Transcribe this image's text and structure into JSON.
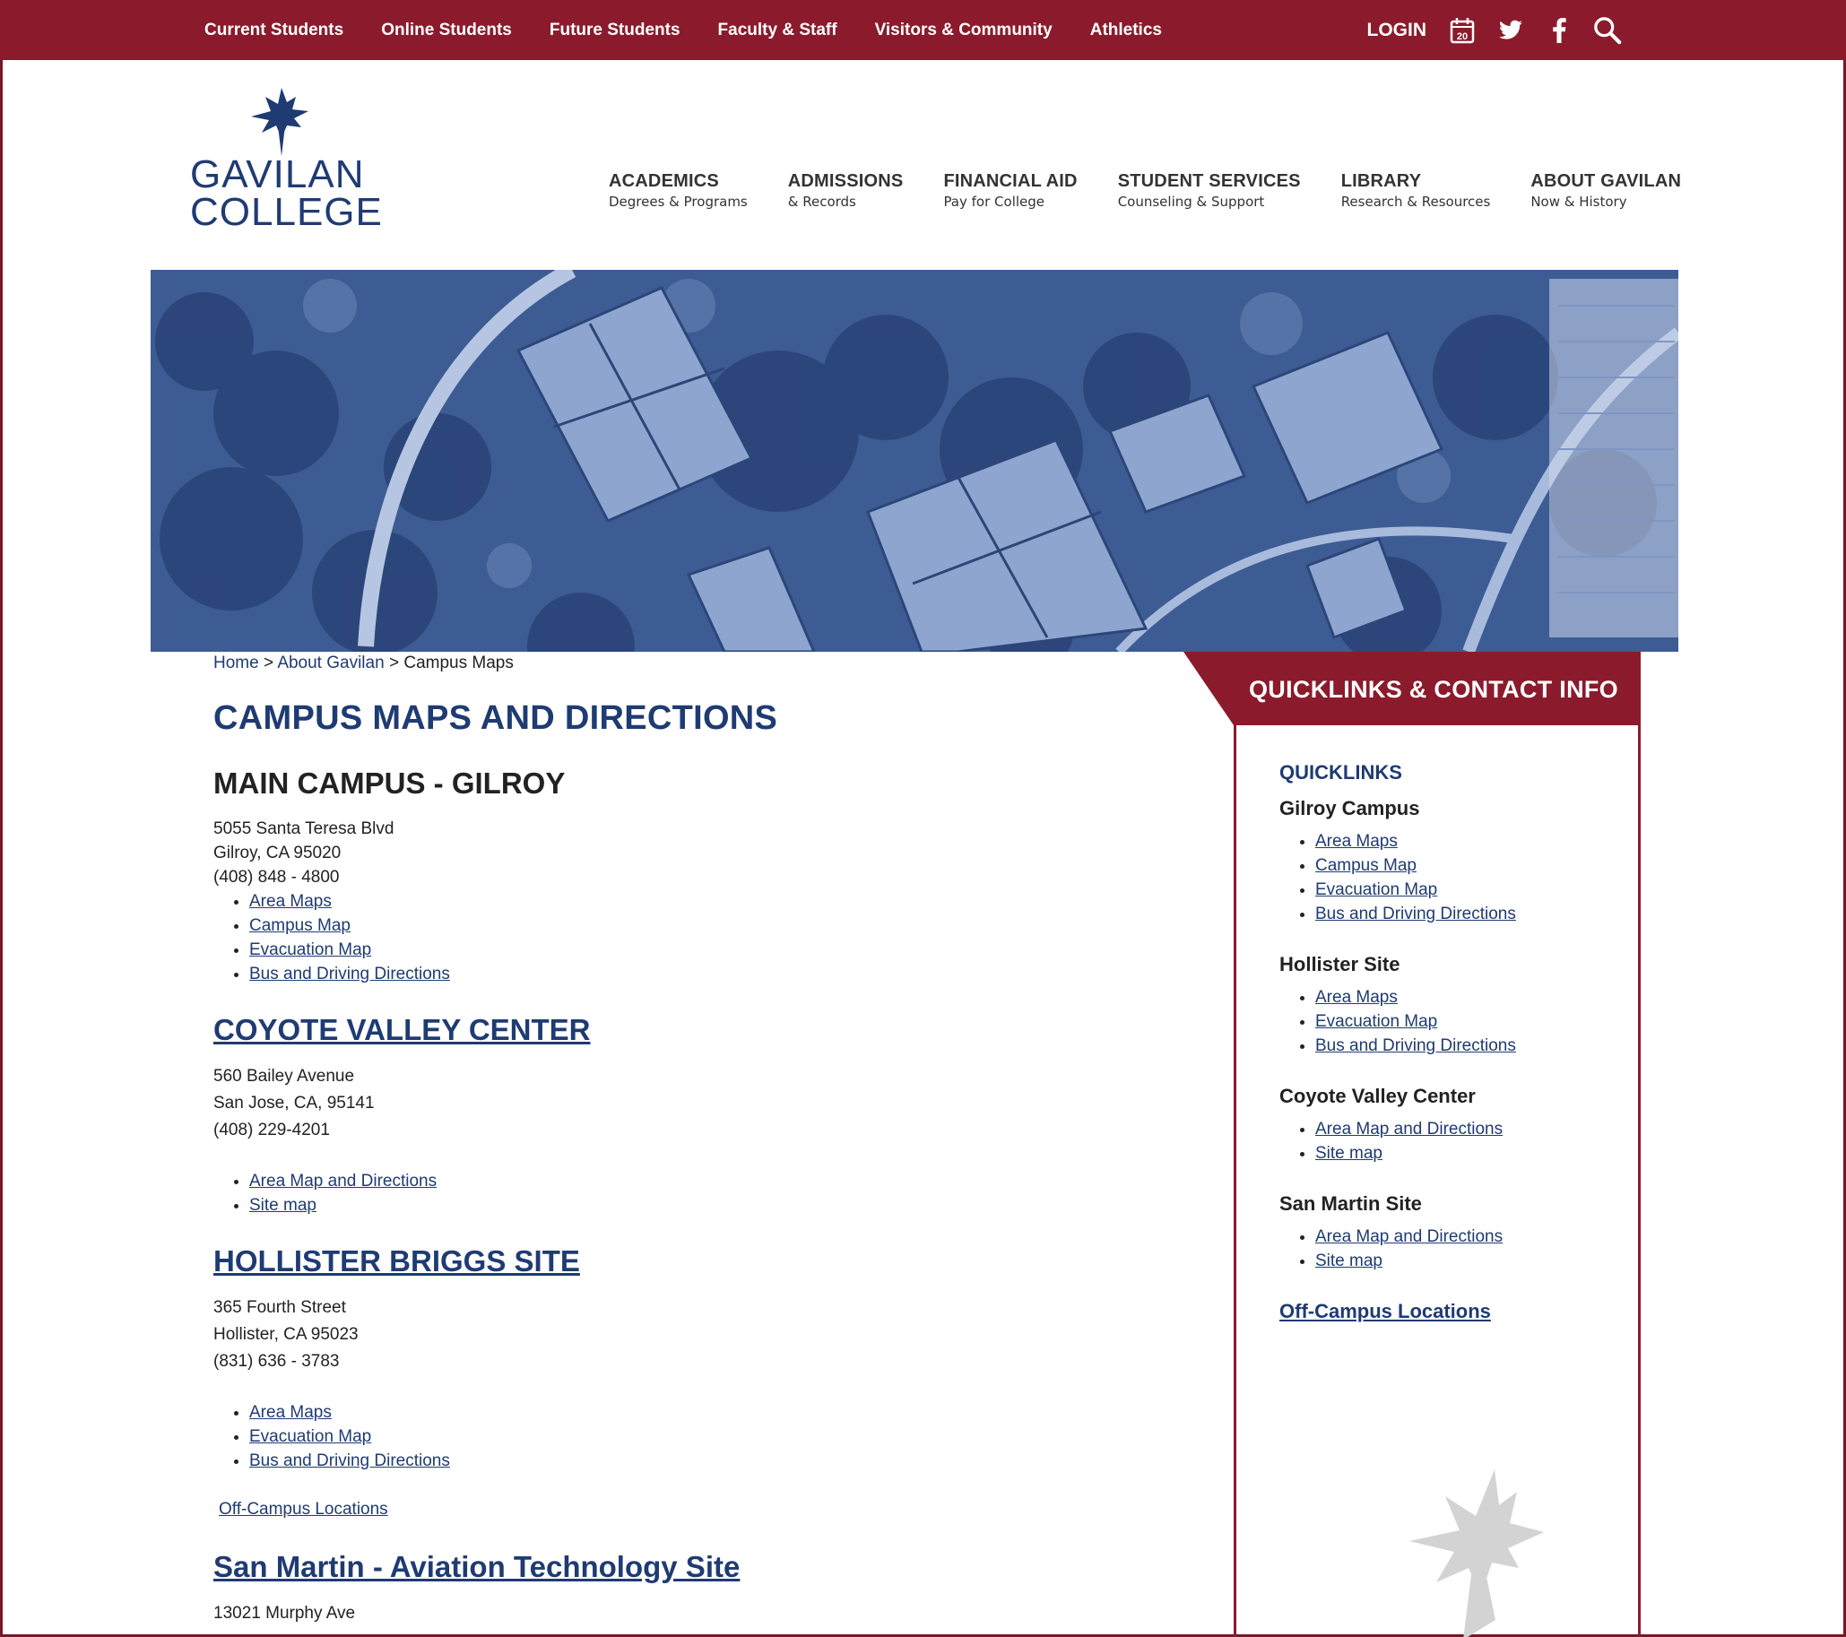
{
  "topbar": {
    "links": [
      "Current Students",
      "Online Students",
      "Future Students",
      "Faculty & Staff",
      "Visitors & Community",
      "Athletics"
    ],
    "login": "LOGIN",
    "calendar_day": "20"
  },
  "logo": {
    "line1": "GAVILAN",
    "line2": "COLLEGE"
  },
  "mainnav": [
    {
      "title": "ACADEMICS",
      "sub": "Degrees & Programs"
    },
    {
      "title": "ADMISSIONS",
      "sub": "& Records"
    },
    {
      "title": "FINANCIAL AID",
      "sub": "Pay for College"
    },
    {
      "title": "STUDENT SERVICES",
      "sub": "Counseling & Support"
    },
    {
      "title": "LIBRARY",
      "sub": "Research & Resources"
    },
    {
      "title": "ABOUT GAVILAN",
      "sub": "Now & History"
    }
  ],
  "breadcrumb": {
    "home": "Home",
    "sep": ">",
    "about": "About Gavilan",
    "current": "Campus Maps"
  },
  "page_title": "CAMPUS MAPS AND DIRECTIONS",
  "main_campus": {
    "heading": "MAIN CAMPUS - GILROY",
    "address": [
      "5055 Santa Teresa Blvd",
      "Gilroy, CA 95020",
      "(408) 848 - 4800"
    ],
    "links": [
      "Area Maps",
      "Campus Map",
      "Evacuation Map",
      "Bus and Driving Directions"
    ]
  },
  "coyote": {
    "heading": "COYOTE VALLEY CENTER",
    "address": [
      "560 Bailey Avenue",
      "San Jose, CA, 95141",
      "(408) 229-4201"
    ],
    "links": [
      "Area Map and Directions",
      "Site map"
    ]
  },
  "hollister": {
    "heading": "HOLLISTER BRIGGS SITE",
    "address": [
      "365 Fourth Street",
      "Hollister, CA 95023",
      "(831) 636 - 3783"
    ],
    "links": [
      "Area Maps",
      "Evacuation Map",
      "Bus and Driving Directions"
    ],
    "off_campus": "Off-Campus Locations"
  },
  "san_martin": {
    "heading": "San Martin - Aviation Technology Site",
    "address": [
      "13021 Murphy Ave"
    ]
  },
  "sidebar": {
    "header": "QUICKLINKS & CONTACT INFO",
    "title": "QUICKLINKS",
    "groups": [
      {
        "name": "Gilroy Campus",
        "links": [
          "Area Maps",
          "Campus Map",
          "Evacuation Map",
          "Bus and Driving Directions"
        ]
      },
      {
        "name": "Hollister Site",
        "links": [
          "Area Maps",
          "Evacuation Map",
          "Bus and Driving Directions"
        ]
      },
      {
        "name": "Coyote Valley Center",
        "links": [
          "Area Map and Directions",
          "Site map"
        ]
      },
      {
        "name": "San Martin Site",
        "links": [
          "Area Map and Directions",
          "Site map"
        ]
      }
    ],
    "off_campus": "Off-Campus Locations"
  },
  "colors": {
    "brand_red": "#8b1b2c",
    "brand_blue": "#1f3b73"
  }
}
